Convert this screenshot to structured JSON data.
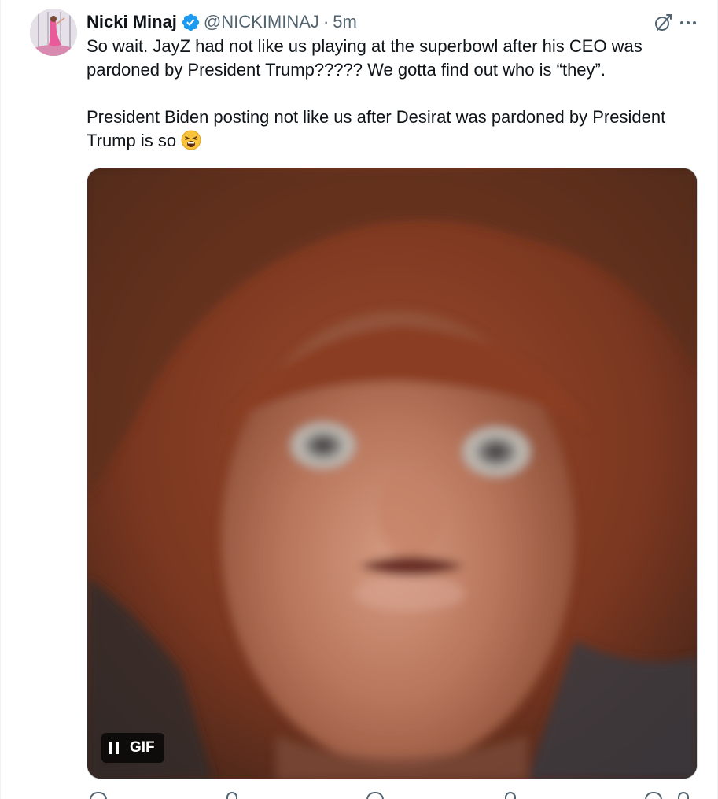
{
  "author": {
    "name": "Nicki Minaj",
    "handle": "@NICKIMINAJ",
    "separator": "·",
    "time": "5m",
    "verified": true
  },
  "tweet": {
    "paragraph1": "So wait. JayZ had not like us playing at the superbowl after his CEO was pardoned by President Trump????? We gotta find out who is “they”.",
    "paragraph2": "President Biden posting not like us after Desirat was pardoned by President Trump is so",
    "emoji": "weary-face"
  },
  "media": {
    "type": "gif",
    "badge_label": "GIF",
    "playback": "playing"
  },
  "icons": {
    "verified": "verified-badge-icon",
    "grok": "grok-icon",
    "more": "more-icon",
    "pause": "pause-icon"
  },
  "colors": {
    "text": "#0f1419",
    "secondary": "#536471",
    "verified": "#1d9bf0"
  }
}
